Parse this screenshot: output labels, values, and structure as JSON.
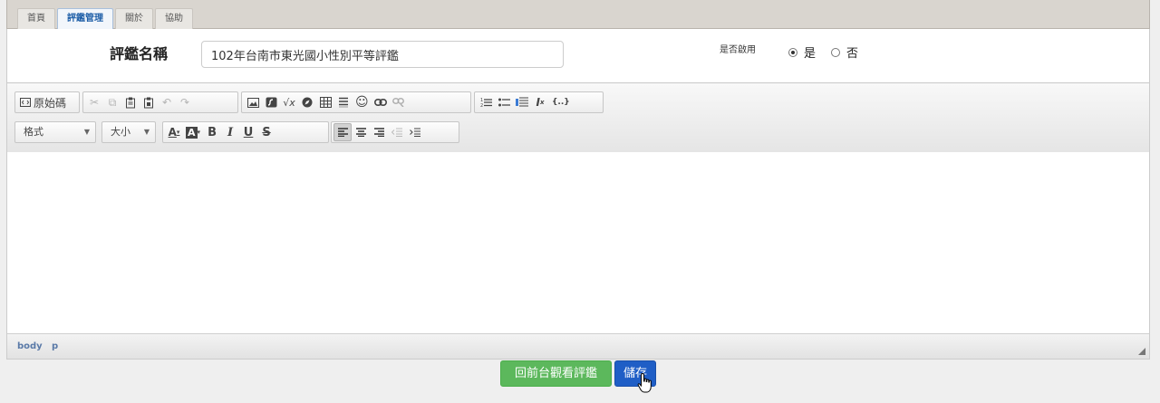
{
  "tabs": [
    {
      "label": "首頁",
      "active": false
    },
    {
      "label": "評鑑管理",
      "active": true
    },
    {
      "label": "關於",
      "active": false
    },
    {
      "label": "協助",
      "active": false
    }
  ],
  "form": {
    "name_label": "評鑑名稱",
    "name_value": "102年台南市東光國小性別平等評鑑",
    "enable_label": "是否啟用",
    "option_yes": "是",
    "option_no": "否",
    "selected": "是"
  },
  "editor": {
    "source_label": "原始碼",
    "format_label": "格式",
    "size_label": "大小",
    "bold_label": "B",
    "italic_label": "I",
    "underline_label": "U",
    "strike_label": "S",
    "path": [
      "body",
      "p"
    ]
  },
  "actions": {
    "front_label": "回前台觀看評鑑",
    "save_label": "儲存"
  },
  "colors": {
    "tab_active": "#1f5fa8",
    "save": "#1f5ec6",
    "front": "#5cb85c"
  }
}
